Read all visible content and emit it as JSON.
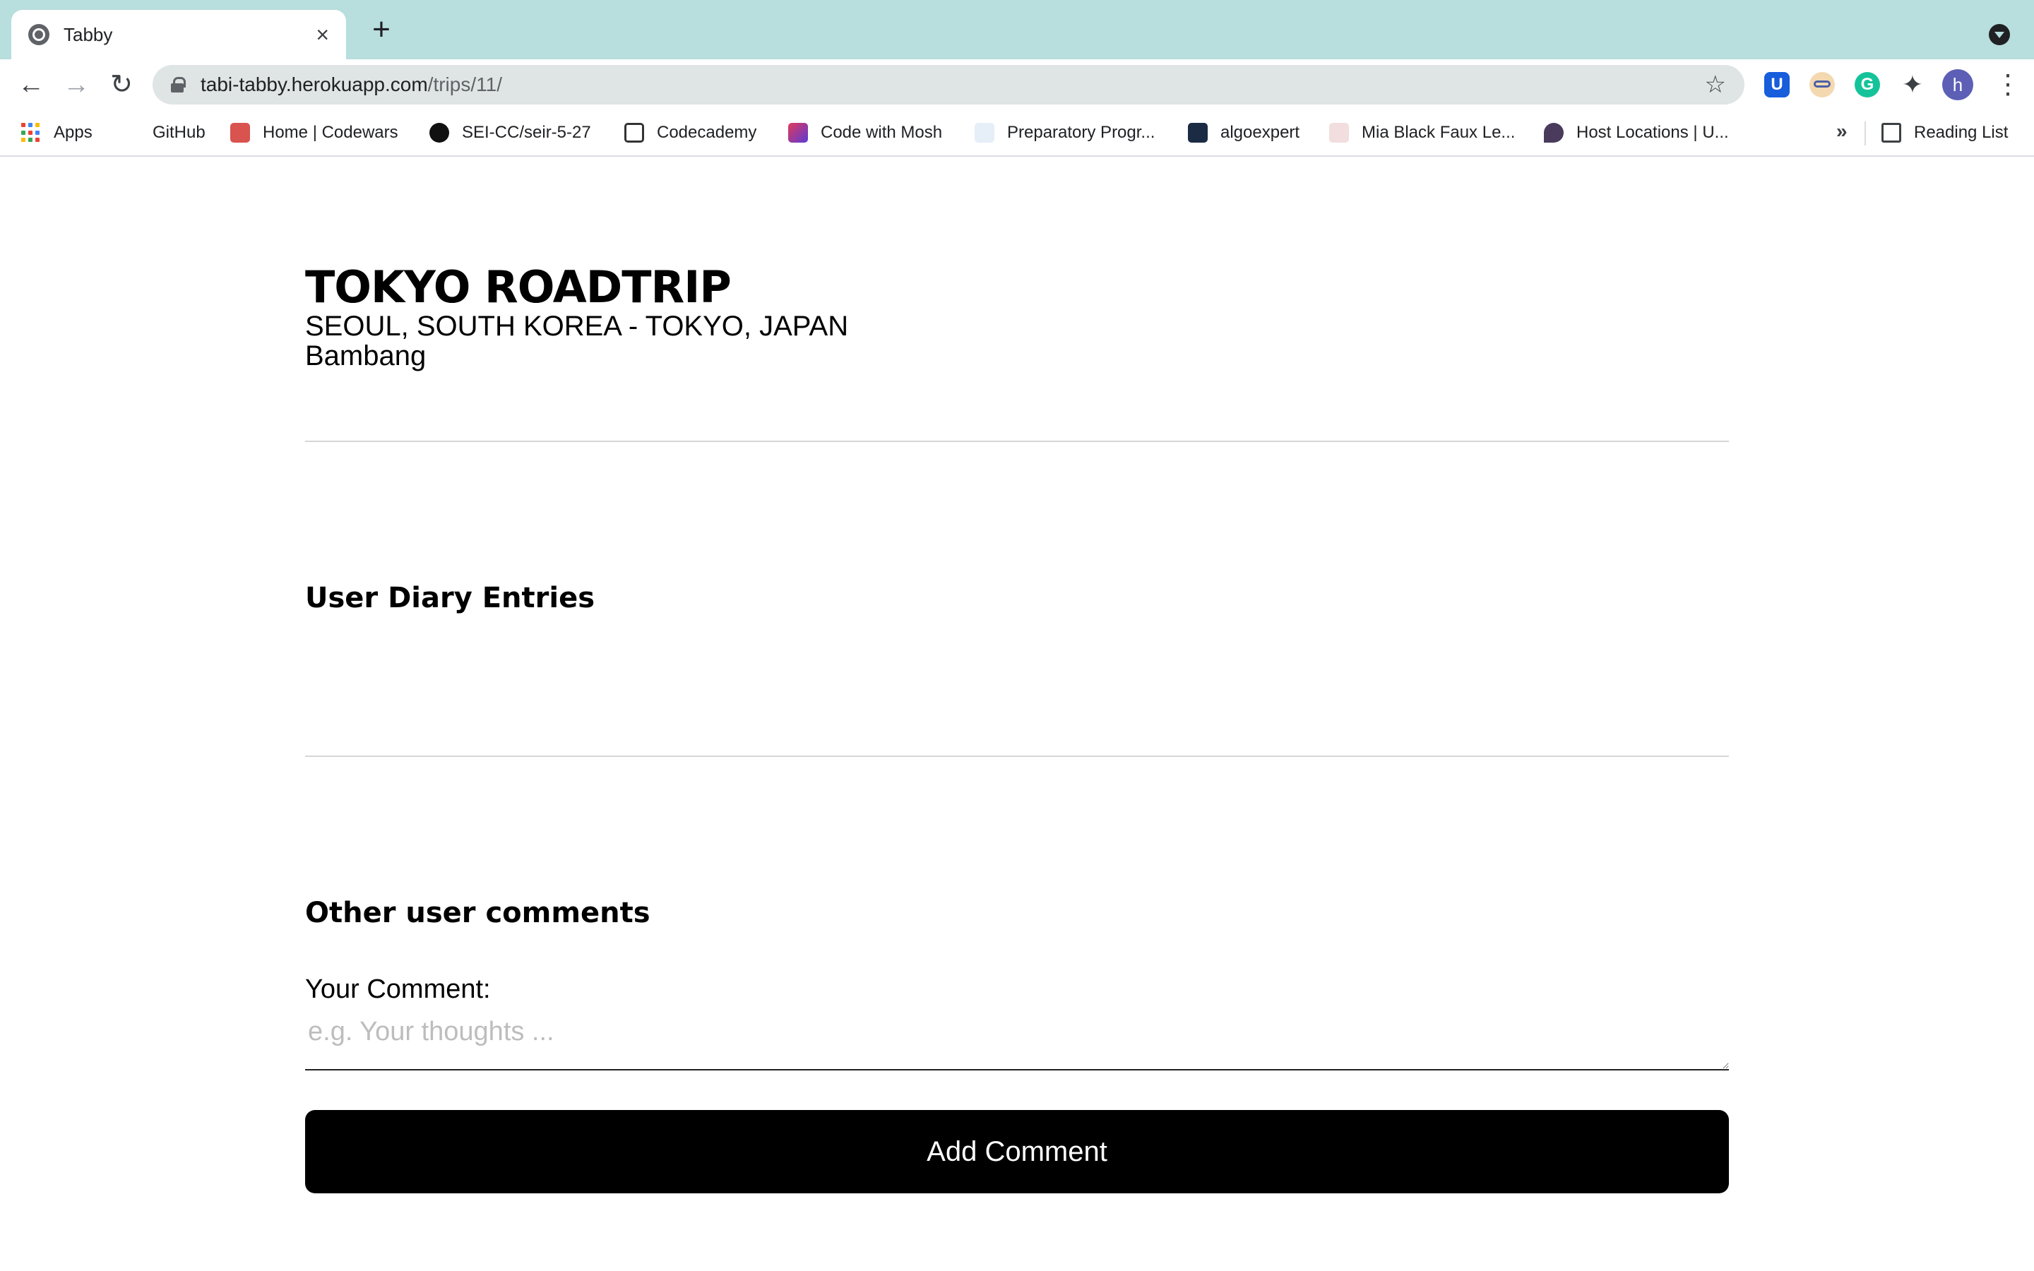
{
  "browser": {
    "tab_title": "Tabby",
    "url_host": "tabi-tabby.herokuapp.com",
    "url_path": "/trips/11/",
    "avatar_letter": "h",
    "bitwarden_letter": "U",
    "grammarly_letter": "G"
  },
  "bookmarks": {
    "items": [
      {
        "label": "Apps",
        "icon": "apps-grid-icon"
      },
      {
        "label": "GitHub",
        "icon": "github-icon"
      },
      {
        "label": "Home | Codewars",
        "icon": "codewars-icon"
      },
      {
        "label": "SEI-CC/seir-5-27",
        "icon": "github-icon"
      },
      {
        "label": "Codecademy",
        "icon": "codecademy-icon"
      },
      {
        "label": "Code with Mosh",
        "icon": "mosh-icon"
      },
      {
        "label": "Preparatory Progr...",
        "icon": "preparatory-icon"
      },
      {
        "label": "algoexpert",
        "icon": "algoexpert-icon"
      },
      {
        "label": "Mia Black Faux Le...",
        "icon": "shop-icon"
      },
      {
        "label": "Host Locations | U...",
        "icon": "location-pin-icon"
      }
    ],
    "more": "»",
    "reading_list": "Reading List"
  },
  "trip": {
    "title": "TOKYO ROADTRIP",
    "route": "SEOUL, SOUTH KOREA - TOKYO, JAPAN",
    "user": "Bambang"
  },
  "sections": {
    "diary_heading": "User Diary Entries",
    "comments_heading": "Other user comments"
  },
  "comment_form": {
    "label": "Your Comment:",
    "placeholder": "e.g. Your thoughts ...",
    "value": "",
    "submit_label": "Add Comment"
  },
  "colors": {
    "tabstrip": "#b8dede",
    "omnibox": "#dfe4e4",
    "button": "#000000",
    "avatar": "#5c5fb5"
  }
}
